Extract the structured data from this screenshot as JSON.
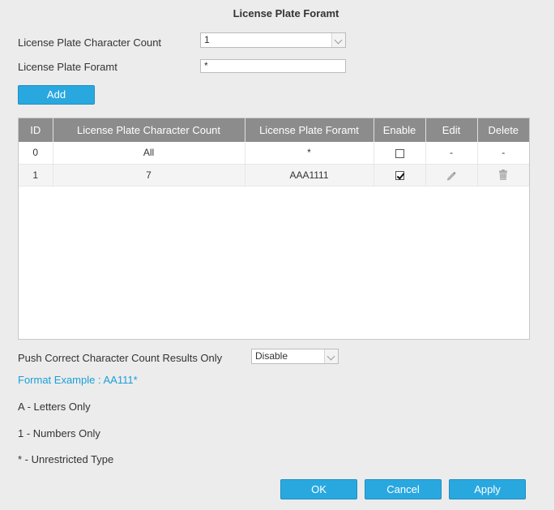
{
  "dialog": {
    "title": "License Plate Foramt"
  },
  "form": {
    "char_count_label": "License Plate Character Count",
    "char_count_value": "1",
    "format_label": "License Plate Foramt",
    "format_value": "*",
    "add_label": "Add"
  },
  "table": {
    "headers": [
      "ID",
      "License Plate Character Count",
      "License Plate Foramt",
      "Enable",
      "Edit",
      "Delete"
    ],
    "rows": [
      {
        "id": "0",
        "count": "All",
        "format": "*",
        "enabled": false,
        "edit": "-",
        "delete": "-"
      },
      {
        "id": "1",
        "count": "7",
        "format": "AAA1111",
        "enabled": true,
        "edit": "pencil-icon",
        "delete": "trash-icon"
      }
    ]
  },
  "push": {
    "label": "Push Correct Character Count Results Only",
    "value": "Disable"
  },
  "help": {
    "example": "Format Example : AA111*",
    "letters": "A - Letters Only",
    "numbers": "1 - Numbers Only",
    "unrestricted": "* - Unrestricted Type"
  },
  "footer": {
    "ok_label": "OK",
    "cancel_label": "Cancel",
    "apply_label": "Apply"
  },
  "colors": {
    "accent": "#29a8e0",
    "header_bg": "#8c8c8c",
    "link": "#1a9fd8"
  }
}
